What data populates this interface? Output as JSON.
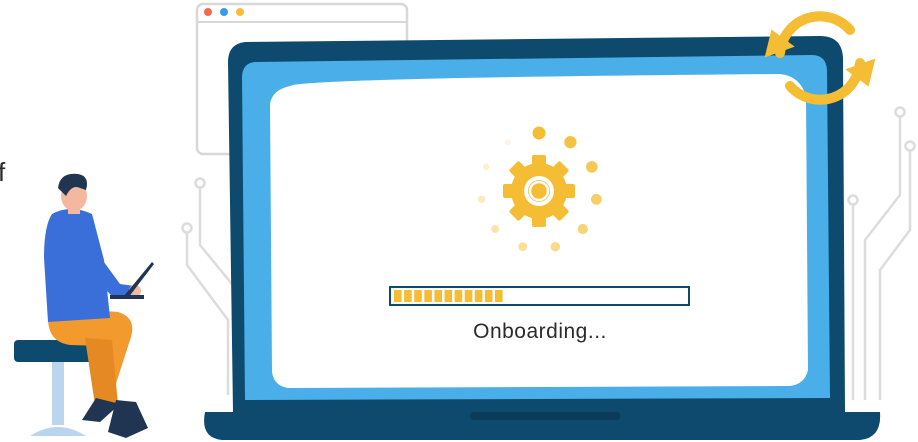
{
  "screen": {
    "status_text": "Onboarding...",
    "edge_fragment": "f",
    "progress": {
      "value_fraction": 0.38,
      "segments_total": 29,
      "segments_filled": 11
    }
  },
  "icons": {
    "gear": "gear-icon",
    "refresh": "refresh-cycle-icon",
    "window_dots": [
      "red",
      "blue",
      "yellow"
    ]
  },
  "colors": {
    "laptop_frame": "#0d4a6e",
    "laptop_bezel": "#4aaee8",
    "screen_bg": "#ffffff",
    "gear": "#f5bd34",
    "progress_fill": "#f5bd34",
    "progress_border": "#0d4a6e",
    "refresh_arrows": "#f5bd34",
    "circuit_lines": "#dcdcdc",
    "person_shirt": "#3a6ed8",
    "person_pants": "#f29a2e",
    "person_hair": "#1f3552",
    "stool_seat": "#0d4a6e",
    "stool_leg": "#bcd5ee",
    "window_dot_red": "#f26b4c",
    "window_dot_blue": "#3a9be8",
    "window_dot_yellow": "#f5bd34"
  }
}
